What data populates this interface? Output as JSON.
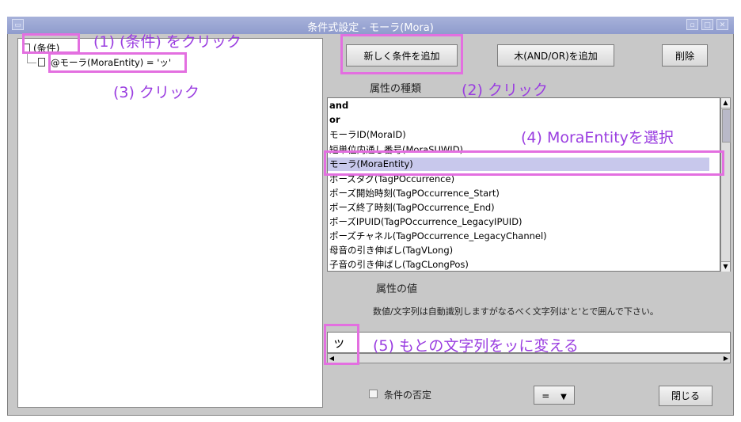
{
  "window": {
    "title": "条件式設定 - モーラ(Mora)"
  },
  "tree": {
    "root_label": "(条件)",
    "child_label": "@モーラ(MoraEntity) = 'ッ'"
  },
  "toolbar": {
    "add_condition": "新しく条件を追加",
    "add_tree": "木(AND/OR)を追加",
    "delete": "削除"
  },
  "attribute_type": {
    "label": "属性の種類",
    "items": [
      "and",
      "or",
      "モーラID(MoraID)",
      "短単位内通し番号(MoraSUWID)",
      "モーラ(MoraEntity)",
      "ポーズタグ(TagPOccurrence)",
      "ポーズ開始時刻(TagPOccurrence_Start)",
      "ポーズ終了時刻(TagPOccurrence_End)",
      "ポーズIPUID(TagPOccurrence_LegacyIPUID)",
      "ポーズチャネル(TagPOccurrence_LegacyChannel)",
      "母音の引き伸ばし(TagVLong)",
      "子音の引き伸ばし(TagCLongPos)"
    ],
    "selected_index": 4
  },
  "attribute_value": {
    "label": "属性の値",
    "hint": "数値/文字列は自動識別しますがなるべく文字列は'と'とで囲んで下さい。",
    "value": "ッ"
  },
  "footer": {
    "negate_label": "条件の否定",
    "operator": "=",
    "close": "閉じる"
  },
  "annotations": {
    "a1": "(1) (条件) をクリック",
    "a2": "(2) クリック",
    "a3": "(3) クリック",
    "a4": "(4) MoraEntityを選択",
    "a5": "(5) もとの文字列をッに変える"
  },
  "colors": {
    "titlebar": "#8f9ccd",
    "highlight": "#e36fe0",
    "annotation": "#9a3de0",
    "selection": "#c8c8ec"
  }
}
